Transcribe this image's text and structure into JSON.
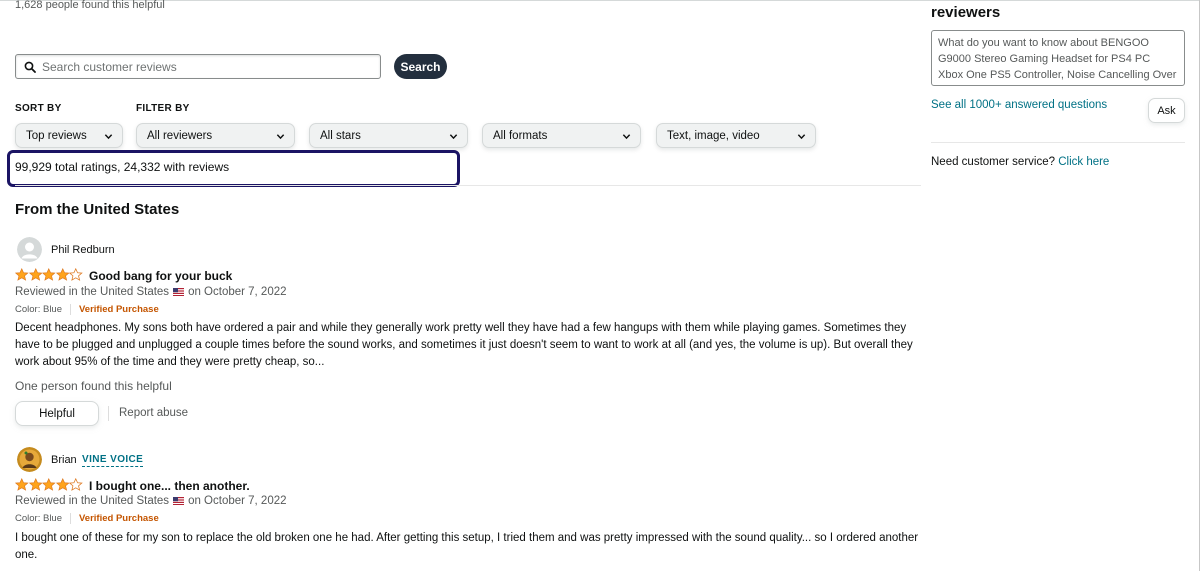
{
  "previous_review": {
    "helpful_text": "1,628 people found this helpful"
  },
  "search": {
    "placeholder": "Search customer reviews",
    "button": "Search"
  },
  "sort": {
    "label": "SORT BY",
    "value": "Top reviews"
  },
  "filter": {
    "label": "FILTER BY",
    "reviewers": "All reviewers",
    "stars": "All stars",
    "formats": "All formats",
    "media": "Text, image, video"
  },
  "ratings_summary": "99,929 total ratings, 24,332 with reviews",
  "section_title": "From the United States",
  "reviews": [
    {
      "reviewer": "Phil Redburn",
      "badge": "",
      "rating": 4,
      "title": "Good bang for your buck",
      "reviewed_in": "Reviewed in the United States",
      "date": "on October 7, 2022",
      "color": "Color: Blue",
      "verified": "Verified Purchase",
      "body": "Decent headphones. My sons both have ordered a pair and while they generally work pretty well they have had a few hangups with them while playing games. Sometimes they have to be plugged and unplugged a couple times before the sound works, and sometimes it just doesn't seem to want to work at all (and yes, the volume is up). But overall they work about 95% of the time and they were pretty cheap, so...",
      "helpful_count": "One person found this helpful",
      "helpful_button": "Helpful",
      "report": "Report abuse"
    },
    {
      "reviewer": "Brian",
      "badge": "VINE VOICE",
      "rating": 4,
      "title": "I bought one... then another.",
      "reviewed_in": "Reviewed in the United States",
      "date": "on October 7, 2022",
      "color": "Color: Blue",
      "verified": "Verified Purchase",
      "body": "I bought one of these for my son to replace the old broken one he had. After getting this setup, I tried them and was pretty impressed with the sound quality... so I ordered another one."
    }
  ],
  "sidebar": {
    "heading": "reviewers",
    "question_placeholder": "What do you want to know about BENGOO G9000 Stereo Gaming Headset for PS4 PC Xbox One PS5 Controller, Noise Cancelling Over Ear Headphones with Mic, LED Light",
    "see_all": "See all 1000+ answered questions",
    "ask_button": "Ask",
    "customer_service_text": "Need customer service?",
    "customer_service_link": "Click here"
  },
  "colors": {
    "star": "#ffa41c",
    "link": "#007185",
    "verified": "#c45500",
    "highlight_border": "#1b1464",
    "search_button": "#232f3e"
  }
}
